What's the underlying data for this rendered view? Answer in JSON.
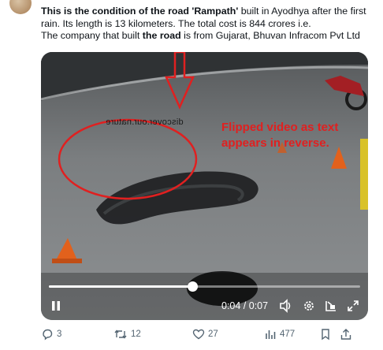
{
  "tweet": {
    "lines": [
      [
        {
          "text": "This is the condition of the road ",
          "bold": true
        },
        {
          "text": "'Rampath'",
          "bold": true
        },
        {
          "text": " built in Ayodhya after the first",
          "bold": false
        }
      ],
      [
        {
          "text": "rain. Its length is 13 kilometers. The total cost is 844 crores i.e.",
          "bold": false
        }
      ],
      [
        {
          "text": "The company that built ",
          "bold": false
        },
        {
          "text": "the road",
          "bold": true
        },
        {
          "text": " is from Gujarat, Bhuvan Infracom Pvt Ltd",
          "bold": false
        }
      ]
    ]
  },
  "video": {
    "watermark_text": "discover.our.nature",
    "annotation_lines": [
      "Flipped video as text",
      "appears in reverse."
    ],
    "annotation_color": "#e02020",
    "current_time": "0:04",
    "duration": "0:07",
    "time_display": "0:04 / 0:07",
    "progress_fraction": 0.46,
    "icons": {
      "play_pause": "pause-icon",
      "volume": "volume-icon",
      "settings": "gear-icon",
      "pip": "picture-in-picture-icon",
      "fullscreen": "fullscreen-icon"
    }
  },
  "actions": {
    "replies": "3",
    "reposts": "12",
    "likes": "27",
    "views": "477"
  }
}
